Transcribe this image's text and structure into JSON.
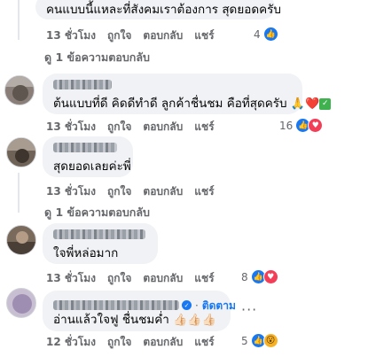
{
  "comments": [
    {
      "text": "คนแบบนี้แหละที่สังคมเราต้องการ สุดยอดครับ",
      "time": "13 ชั่วโมง",
      "like_label": "ถูกใจ",
      "reply_label": "ตอบกลับ",
      "share_label": "แชร์",
      "reaction_count": "4",
      "reactions": [
        "like"
      ]
    },
    {
      "text": "ต้นแบบที่ดี คิดดีทำดี ลูกค้าชื่นชม คือที่สุดครับ",
      "emojis": [
        "🙏",
        "❤️",
        "✅"
      ],
      "time": "13 ชั่วโมง",
      "like_label": "ถูกใจ",
      "reply_label": "ตอบกลับ",
      "share_label": "แชร์",
      "reaction_count": "16",
      "reactions": [
        "like",
        "love"
      ]
    },
    {
      "text": "สุดยอดเลยค่ะพี่",
      "time": "13 ชั่วโมง",
      "like_label": "ถูกใจ",
      "reply_label": "ตอบกลับ",
      "share_label": "แชร์"
    },
    {
      "text": "ใจพี่หล่อมาก",
      "time": "13 ชั่วโมง",
      "like_label": "ถูกใจ",
      "reply_label": "ตอบกลับ",
      "share_label": "แชร์",
      "reaction_count": "8",
      "reactions": [
        "like",
        "love"
      ]
    },
    {
      "follow_label": "ติดตาม",
      "separator": "·",
      "text": "อ่านแล้วใจฟู ชื่นชมค่ำ",
      "emojis": [
        "👍🏻",
        "👍🏻",
        "👍🏻"
      ],
      "time": "12 ชั่วโมง",
      "like_label": "ถูกใจ",
      "reply_label": "ตอบกลับ",
      "share_label": "แชร์",
      "reaction_count": "5",
      "reactions": [
        "like",
        "wow"
      ],
      "more_label": "···"
    }
  ],
  "replies_link_1": "ดู 1 ข้อความตอบกลับ",
  "replies_link_2": "ดู 1 ข้อความตอบกลับ",
  "colors": {
    "bubble": "#f0f2f5",
    "meta": "#65676b",
    "like": "#1877f2",
    "love": "#f33e58",
    "wow": "#f7b125"
  }
}
